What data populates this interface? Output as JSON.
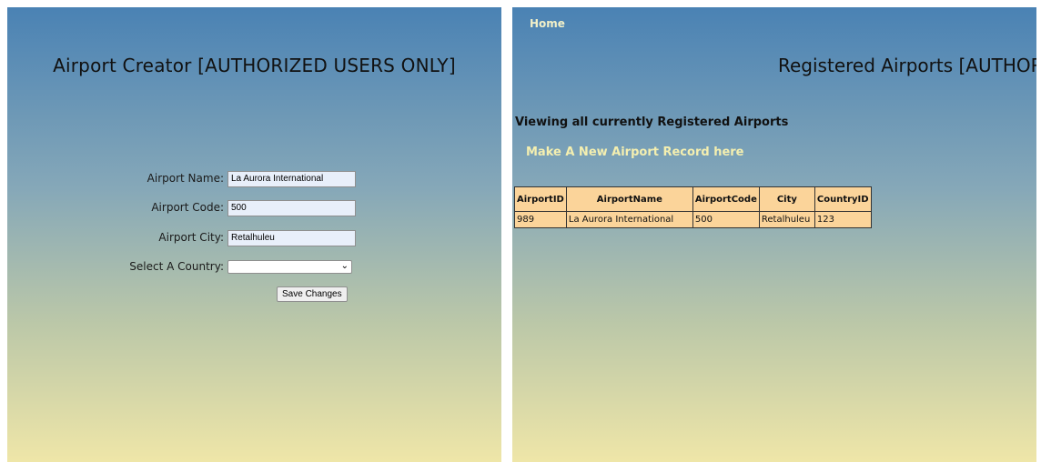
{
  "creator": {
    "title": "Airport Creator [AUTHORIZED USERS ONLY]",
    "fields": {
      "name_label": "Airport Name:",
      "name_value": "La Aurora International",
      "code_label": "Airport Code:",
      "code_value": "500",
      "city_label": "Airport City:",
      "city_value": "Retalhuleu",
      "country_label": "Select A Country:",
      "country_value": ""
    },
    "save_label": "Save Changes"
  },
  "registry": {
    "nav_home": "Home",
    "title": "Registered Airports [AUTHORI",
    "viewing_text": "Viewing all currently Registered Airports",
    "new_record_link": "Make A New Airport Record here",
    "table": {
      "columns": [
        "AirportID",
        "AirportName",
        "AirportCode",
        "City",
        "CountryID"
      ],
      "rows": [
        [
          "989",
          "La Aurora International",
          "500",
          "Retalhuleu",
          "123"
        ]
      ]
    }
  },
  "colors": {
    "gradient_top": "#4a82b4",
    "gradient_bottom": "#efe6a8",
    "link": "#f4efb0",
    "table_bg": "#fbd49a"
  }
}
